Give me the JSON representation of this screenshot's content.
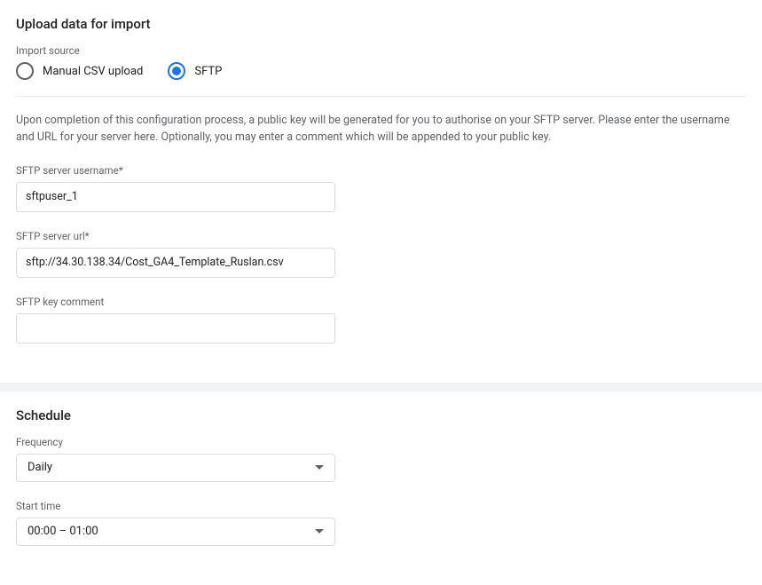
{
  "upload": {
    "title": "Upload data for import",
    "import_source_label": "Import source",
    "radio_manual": "Manual CSV upload",
    "radio_sftp": "SFTP",
    "help_text": "Upon completion of this configuration process, a public key will be generated for you to authorise on your SFTP server. Please enter the username and URL for your server here. Optionally, you may enter a comment which will be appended to your public key.",
    "username_label": "SFTP server username*",
    "username_value": "sftpuser_1",
    "url_label": "SFTP server url*",
    "url_value": "sftp://34.30.138.34/Cost_GA4_Template_Ruslan.csv",
    "comment_label": "SFTP key comment",
    "comment_value": ""
  },
  "schedule": {
    "title": "Schedule",
    "frequency_label": "Frequency",
    "frequency_value": "Daily",
    "start_time_label": "Start time",
    "start_time_value": "00:00 – 01:00"
  }
}
